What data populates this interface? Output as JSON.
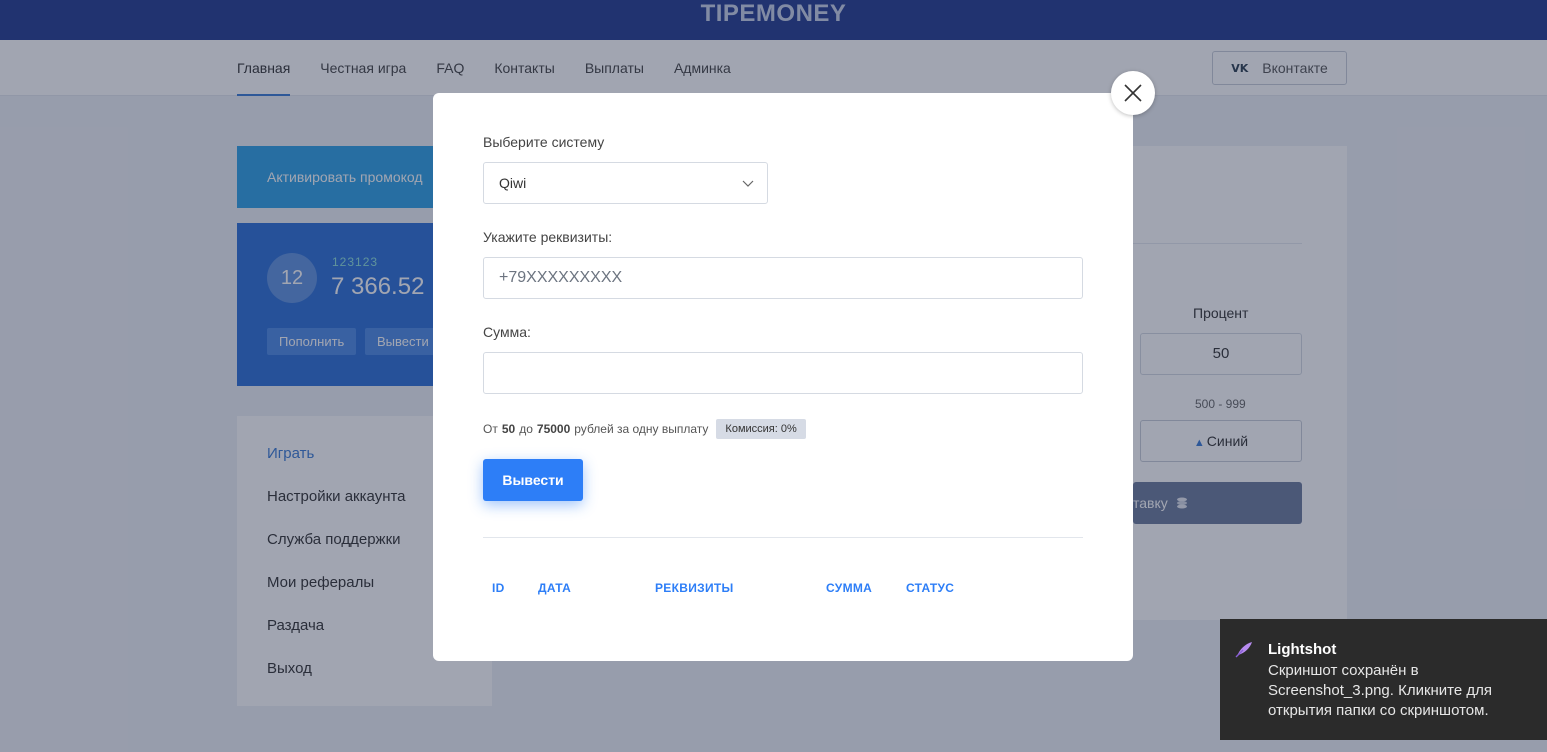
{
  "brand": "TIPEMONEY",
  "nav": {
    "items": [
      "Главная",
      "Честная игра",
      "FAQ",
      "Контакты",
      "Выплаты",
      "Админка"
    ],
    "active_index": 0,
    "vk_label": "Вконтакте",
    "vk_icon": "vk-icon"
  },
  "promo_label": "Активировать промокод",
  "balance_card": {
    "avatar": "12",
    "name": "123123",
    "amount": "7 366.52",
    "deposit_label": "Пополнить",
    "withdraw_label": "Вывести"
  },
  "menu": {
    "items": [
      "Играть",
      "Настройки аккаунта",
      "Служба поддержки",
      "Мои рефералы",
      "Раздача",
      "Выход"
    ],
    "active_index": 0
  },
  "game": {
    "percent_label": "Процент",
    "percent_value": "50",
    "range": "500 - 999",
    "blue_label": "Синий",
    "bet_label": "тавку"
  },
  "modal": {
    "system_label": "Выберите систему",
    "system_value": "Qiwi",
    "requisites_label": "Укажите реквизиты:",
    "requisites_placeholder": "+79XXXXXXXXX",
    "amount_label": "Сумма:",
    "amount_value": "",
    "limits": {
      "from_word": "От",
      "min": "50",
      "to_word": "до",
      "max": "75000",
      "suffix": "рублей за одну выплату",
      "commission": "Комиссия: 0%"
    },
    "submit_label": "Вывести",
    "table_headers": [
      "ID",
      "ДАТА",
      "РЕКВИЗИТЫ",
      "СУММА",
      "СТАТУС"
    ]
  },
  "toast": {
    "title": "Lightshot",
    "body": "Скриншот сохранён в Screenshot_3.png. Кликните для открытия папки со скриншотом."
  },
  "colors": {
    "brand_bar": "#243b8f",
    "accent": "#2d7ef7",
    "promo": "#2da1e6",
    "card": "#2b6fd6",
    "toast_bg": "#2b2b2b"
  }
}
